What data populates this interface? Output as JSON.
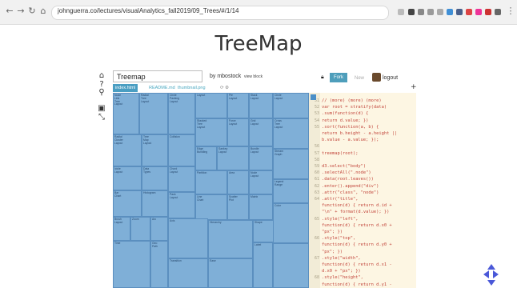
{
  "browser": {
    "url": "johnguerra.co/lectures/visualAnalytics_fall2019/09_Trees/#/1/14"
  },
  "slide": {
    "title": "TreeMap"
  },
  "blocks": {
    "doc_title": "Treemap",
    "author": "by mbostock",
    "view_block": "view block",
    "fork_label": "Fork",
    "new_label": "New",
    "logout_label": "logout",
    "files": [
      "index.html",
      "README.md",
      "thumbnail.png"
    ]
  },
  "treemap": {
    "cells": [
      {
        "label": "Node\nLink\nTree\nLayout"
      },
      {
        "label": "Radial\nTree\nLayout"
      },
      {
        "label": "Circle\nPacking\nLayout"
      },
      {
        "label": "Layout"
      },
      {
        "label": "Pie\nLayout"
      },
      {
        "label": "Stack\nLayout"
      },
      {
        "label": "Circle\nLayout"
      },
      {
        "label": "Radial\nCluster\nLayout"
      },
      {
        "label": "Tree\nMap\nLayout"
      },
      {
        "label": "Stacked\nTree\nLayout"
      },
      {
        "label": "Force\nLayout"
      },
      {
        "label": "Grid\nLayout"
      },
      {
        "label": "Cross\nTree\nLayout"
      },
      {
        "label": "Icicle\nLayout"
      },
      {
        "label": "Data\nTypes"
      },
      {
        "label": "Collision"
      },
      {
        "label": "Chord\nLayout"
      },
      {
        "label": "Edge\nBundling"
      },
      {
        "label": "Sankey\nLayout"
      },
      {
        "label": "Bundle\nLayout"
      },
      {
        "label": "Stream\nGraph"
      },
      {
        "label": "Bar\nChart"
      },
      {
        "label": "Histogram"
      },
      {
        "label": "Pack\nLayout"
      },
      {
        "label": "Partition"
      },
      {
        "label": "Area"
      },
      {
        "label": "Node\nLayout"
      },
      {
        "label": "Legend\nRange"
      },
      {
        "label": "Line\nChart"
      },
      {
        "label": "Scatter\nPlot"
      },
      {
        "label": "Matrix"
      },
      {
        "label": "Brush\nLayout"
      },
      {
        "label": "Zoom"
      },
      {
        "label": "Arc"
      },
      {
        "label": "Axis"
      },
      {
        "label": "Hierarchy"
      },
      {
        "label": "Shape"
      },
      {
        "label": "Color"
      },
      {
        "label": "Time"
      },
      {
        "label": "Geo\nPath"
      },
      {
        "label": "Transition"
      },
      {
        "label": "Ease"
      },
      {
        "label": "Label"
      }
    ]
  },
  "editor": {
    "lines": [
      {
        "n": "51",
        "t": "  // (more) (more) (more)"
      },
      {
        "n": "52",
        "t": "  var root = stratify(data)"
      },
      {
        "n": "53",
        "t": "      .sum(function(d) {"
      },
      {
        "n": "54",
        "t": "  return d.value; })"
      },
      {
        "n": "55",
        "t": "      .sort(function(a, b) {"
      },
      {
        "n": "",
        "t": "  return b.height - a.height ||"
      },
      {
        "n": "",
        "t": "  b.value - a.value; });"
      },
      {
        "n": "56",
        "t": ""
      },
      {
        "n": "57",
        "t": "    treemap(root);"
      },
      {
        "n": "58",
        "t": ""
      },
      {
        "n": "59",
        "t": "    d3.select(\"body\")"
      },
      {
        "n": "60",
        "t": "      .selectAll(\".node\")"
      },
      {
        "n": "61",
        "t": "      .data(root.leaves())"
      },
      {
        "n": "62",
        "t": "      .enter().append(\"div\")"
      },
      {
        "n": "63",
        "t": "        .attr(\"class\", \"node\")"
      },
      {
        "n": "64",
        "t": "        .attr(\"title\","
      },
      {
        "n": "",
        "t": "  function(d) { return d.id +"
      },
      {
        "n": "",
        "t": "  \"\\n\" + format(d.value); })"
      },
      {
        "n": "65",
        "t": "        .style(\"left\","
      },
      {
        "n": "",
        "t": "  function(d) { return d.x0 +"
      },
      {
        "n": "",
        "t": "  \"px\"; })"
      },
      {
        "n": "66",
        "t": "        .style(\"top\","
      },
      {
        "n": "",
        "t": "  function(d) { return d.y0 +"
      },
      {
        "n": "",
        "t": "  \"px\"; })"
      },
      {
        "n": "67",
        "t": "        .style(\"width\","
      },
      {
        "n": "",
        "t": "  function(d) { return d.x1 -"
      },
      {
        "n": "",
        "t": "  d.x0 + \"px\"; })"
      },
      {
        "n": "68",
        "t": "        .style(\"height\","
      },
      {
        "n": "",
        "t": "  function(d) { return d.y1 -"
      }
    ]
  },
  "colors": {
    "treemap_fill": "#7fafd7",
    "treemap_border": "#5b8fbf",
    "editor_bg": "#fdf6e3",
    "code_text": "#c2463c",
    "accent": "#4e9ebb"
  }
}
